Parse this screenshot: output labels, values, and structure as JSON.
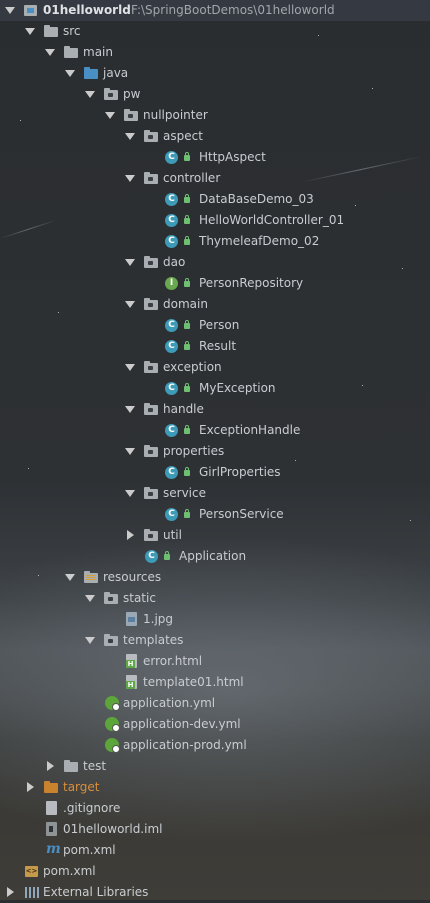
{
  "project": {
    "name": "01helloworld",
    "path": "F:\\SpringBootDemos\\01helloworld"
  },
  "tree": {
    "src": "src",
    "main": "main",
    "java": "java",
    "pw": "pw",
    "nullpointer": "nullpointer",
    "aspect": "aspect",
    "http_aspect": "HttpAspect",
    "controller": "controller",
    "database_demo": "DataBaseDemo_03",
    "hello_controller": "HelloWorldController_01",
    "thymeleaf_demo": "ThymeleafDemo_02",
    "dao": "dao",
    "person_repository": "PersonRepository",
    "domain": "domain",
    "person": "Person",
    "result": "Result",
    "exception": "exception",
    "my_exception": "MyException",
    "handle": "handle",
    "exception_handle": "ExceptionHandle",
    "properties": "properties",
    "girl_properties": "GirlProperties",
    "service": "service",
    "person_service": "PersonService",
    "util": "util",
    "application": "Application",
    "resources": "resources",
    "static": "static",
    "jpg": "1.jpg",
    "templates": "templates",
    "error_html": "error.html",
    "template01_html": "template01.html",
    "application_yml": "application.yml",
    "application_dev_yml": "application-dev.yml",
    "application_prod_yml": "application-prod.yml",
    "test": "test",
    "target": "target",
    "gitignore": ".gitignore",
    "iml": "01helloworld.iml",
    "pom_inner": "pom.xml",
    "pom_outer": "pom.xml",
    "external_libraries": "External Libraries"
  },
  "icons": {
    "class_letter": "C",
    "interface_letter": "I"
  },
  "colors": {
    "accent_blue": "#4a8fc3",
    "class_icon": "#3e9bb8",
    "interface_icon": "#6aa84f",
    "target_folder": "#d88e39"
  }
}
